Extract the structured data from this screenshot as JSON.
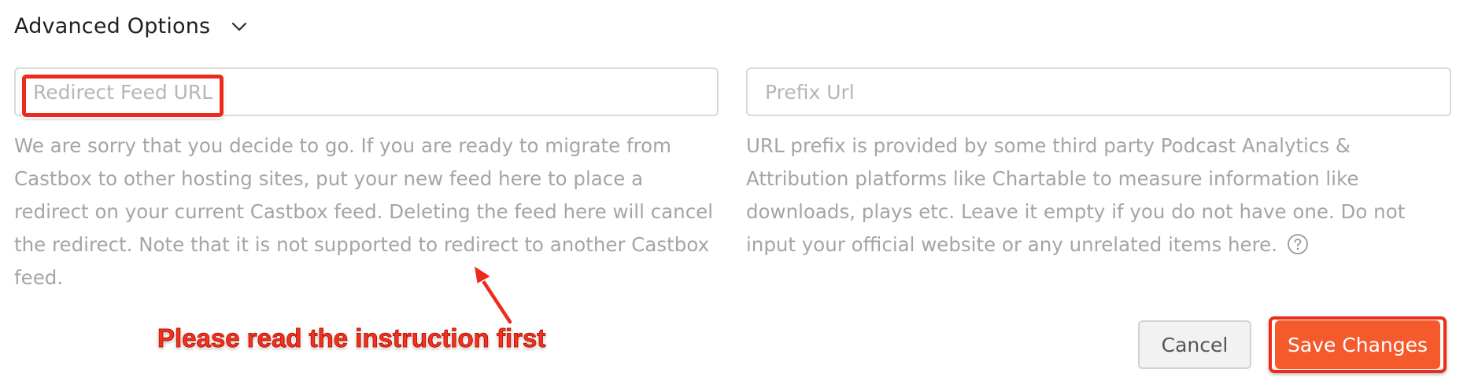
{
  "advanced": {
    "title": "Advanced Options"
  },
  "redirect": {
    "placeholder": "Redirect Feed URL",
    "value": "",
    "help": "We are sorry that you decide to go. If you are ready to migrate from Castbox to other hosting sites, put your new feed here to place a redirect on your current Castbox feed. Deleting the feed here will cancel the redirect. Note that it is not supported to redirect to another Castbox feed."
  },
  "prefix": {
    "placeholder": "Prefix Url",
    "value": "",
    "help": "URL prefix is provided by some third party Podcast Analytics & Attribution platforms like Chartable to measure information like downloads, plays etc. Leave it empty if you do not have one. Do not input your official website or any unrelated items here."
  },
  "annotation": {
    "text": "Please read the instruction first",
    "color": "#ec2b1b"
  },
  "actions": {
    "cancel_label": "Cancel",
    "save_label": "Save Changes",
    "save_color": "#f55a2c"
  },
  "icons": {
    "toggle": "chevron-down-icon",
    "help": "question-circle-icon"
  }
}
